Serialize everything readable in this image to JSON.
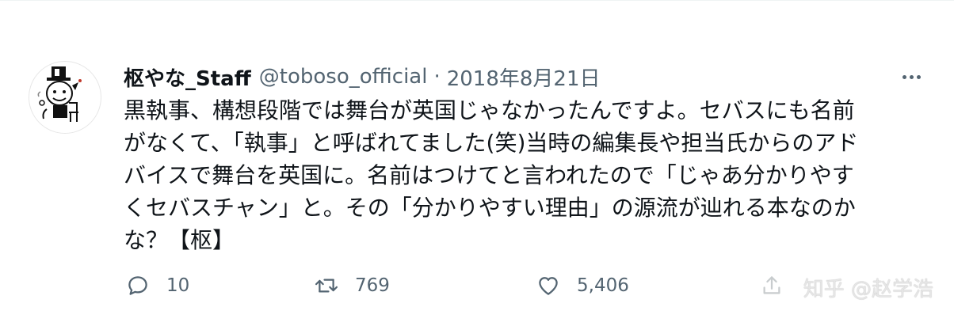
{
  "tweet": {
    "display_name": "枢やな_Staff",
    "handle": "@toboso_official",
    "separator": "·",
    "date": "2018年8月21日",
    "lines": [
      "黒執事、構想段階では舞台が英国じゃなかったんですよ。セバスにも名前",
      "がなくて、「執事」と呼ばれてました(笑)当時の編集長や担当氏からのアド",
      "バイスで舞台を英国に。名前はつけてと言われたので「じゃあ分かりやす",
      "くセバスチャン」と。その「分かりやすい理由」の源流が辿れる本なのか",
      "な？【枢】"
    ]
  },
  "actions": {
    "reply_count": "10",
    "retweet_count": "769",
    "like_count": "5,406"
  },
  "watermark": "知乎 @赵学浩",
  "colors": {
    "text": "#0f1419",
    "secondary": "#536471",
    "icon": "#536471"
  }
}
